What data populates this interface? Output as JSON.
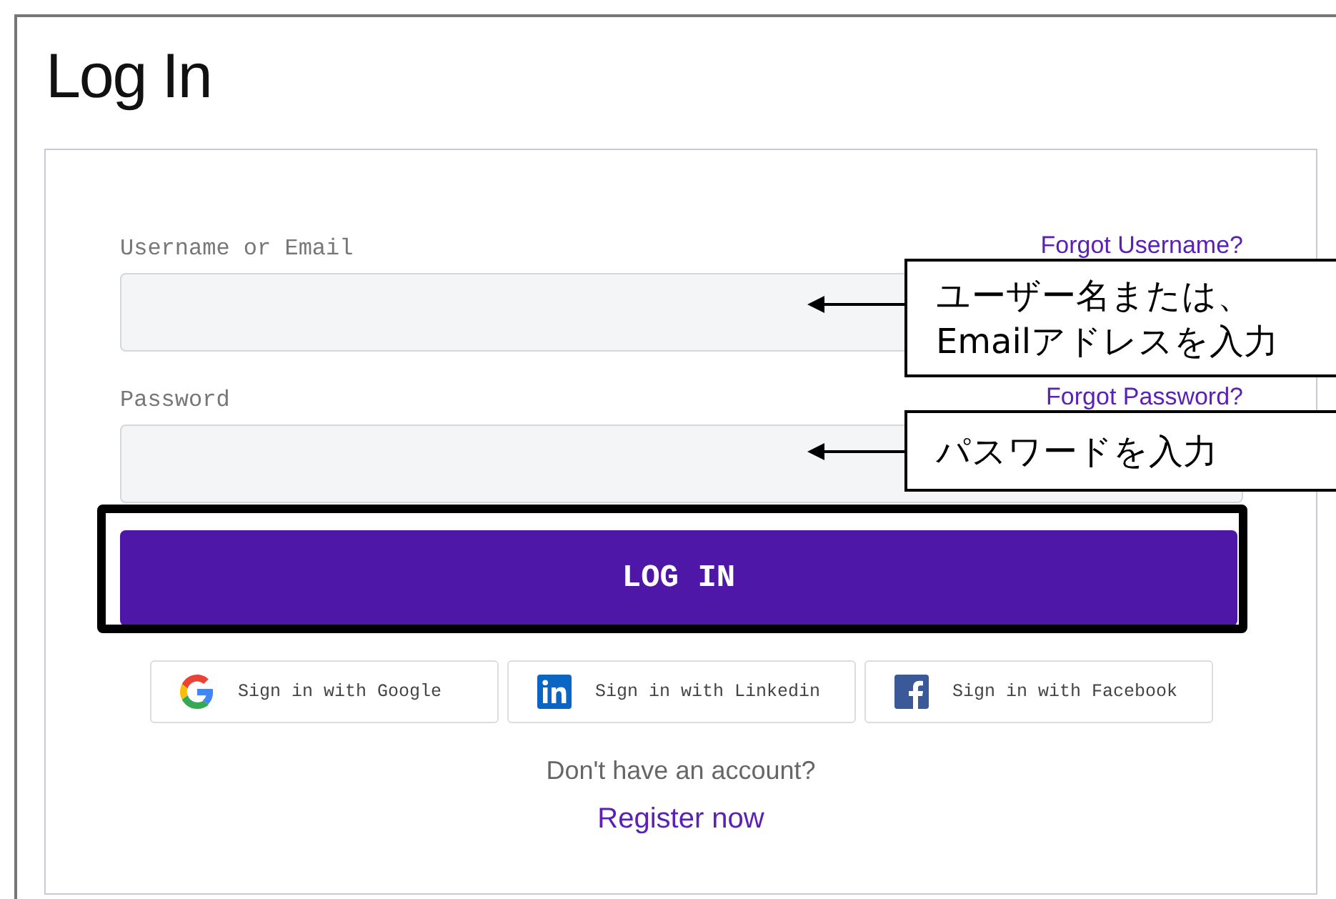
{
  "title": "Log In",
  "fields": [
    {
      "label": "Username or Email",
      "link": "Forgot Username?"
    },
    {
      "label": "Password",
      "link": "Forgot Password?"
    }
  ],
  "login_button": "LOG IN",
  "social": [
    {
      "kind": "google",
      "label": "Sign in with Google"
    },
    {
      "kind": "linkedin",
      "label": "Sign in with Linkedin"
    },
    {
      "kind": "facebook",
      "label": "Sign in with Facebook"
    }
  ],
  "prompt": "Don't have an account?",
  "register_link": "Register now",
  "callouts": [
    {
      "text": "ユーザー名または、\nEmailアドレスを入力"
    },
    {
      "text": "パスワードを入力"
    }
  ]
}
